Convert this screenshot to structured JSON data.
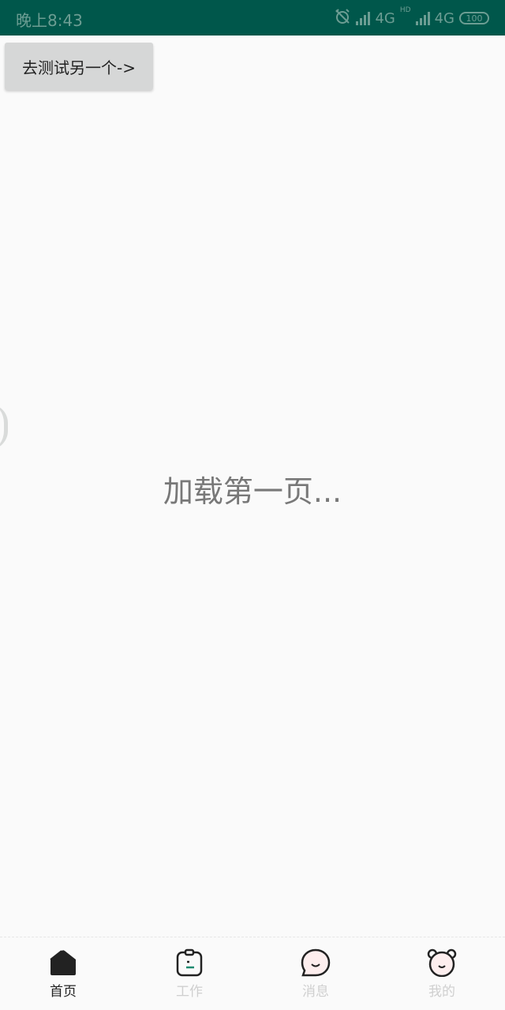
{
  "status_bar": {
    "time": "晚上8:43",
    "network1": "4G",
    "network2": "4G",
    "hd_label": "HD",
    "battery": "100",
    "color": "#00574b"
  },
  "toolbar": {
    "test_button_label": "去测试另一个->"
  },
  "main": {
    "loading_text": "加载第一页..."
  },
  "bottom_nav": {
    "items": [
      {
        "label": "首页",
        "icon": "home-icon",
        "active": true
      },
      {
        "label": "工作",
        "icon": "clipboard-icon",
        "active": false
      },
      {
        "label": "消息",
        "icon": "message-bubble-icon",
        "active": false
      },
      {
        "label": "我的",
        "icon": "bear-face-icon",
        "active": false
      }
    ]
  }
}
